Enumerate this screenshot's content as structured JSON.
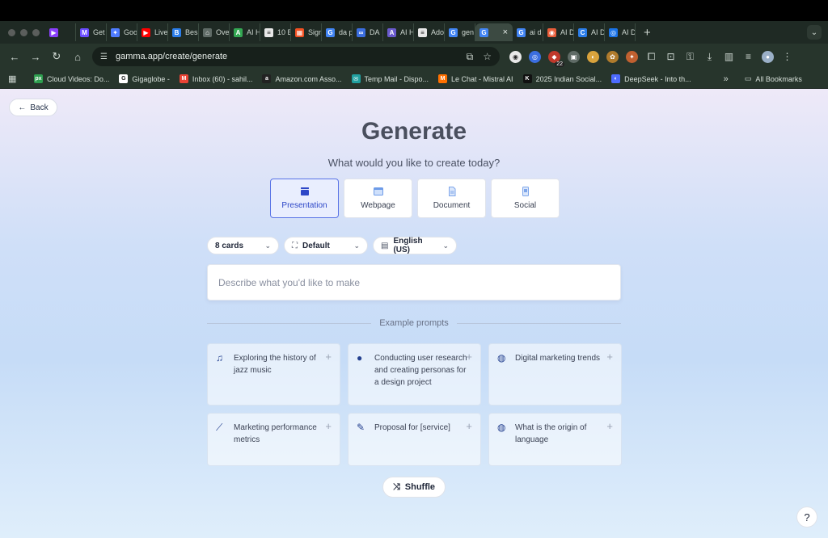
{
  "browser": {
    "tabs": [
      {
        "label": "",
        "fav": "▶",
        "color": "#8a3ffc"
      },
      {
        "label": "Get",
        "fav": "M",
        "color": "#6b4cff"
      },
      {
        "label": "Goo",
        "fav": "✦",
        "color": "#4f7cff"
      },
      {
        "label": "Live",
        "fav": "▶",
        "color": "#ff0000"
      },
      {
        "label": "Bes",
        "fav": "B",
        "color": "#2b7de9"
      },
      {
        "label": "Ove",
        "fav": "⌂",
        "color": "#5f6b66"
      },
      {
        "label": "AI H",
        "fav": "A",
        "color": "#34a853"
      },
      {
        "label": "10 B",
        "fav": "≡",
        "color": "#e8e8e8"
      },
      {
        "label": "Sign",
        "fav": "▦",
        "color": "#f25022"
      },
      {
        "label": "da p",
        "fav": "G",
        "color": "#4285f4"
      },
      {
        "label": "DA",
        "fav": "∞",
        "color": "#3b6ee0"
      },
      {
        "label": "AI H",
        "fav": "A",
        "color": "#6a5acd"
      },
      {
        "label": "Ado",
        "fav": "≡",
        "color": "#e8e8e8"
      },
      {
        "label": "gen",
        "fav": "G",
        "color": "#4285f4"
      }
    ],
    "active_tab": {
      "label": "G",
      "fav": "G"
    },
    "tabs_after": [
      {
        "label": "ai d",
        "fav": "G",
        "color": "#4285f4"
      },
      {
        "label": "AI D",
        "fav": "◉",
        "color": "#e85d3a"
      },
      {
        "label": "AI D",
        "fav": "C",
        "color": "#2b7de9"
      },
      {
        "label": "AI D",
        "fav": "◎",
        "color": "#1a73e8"
      }
    ],
    "new_tab": "+",
    "tab_menu": "⌄",
    "url": "gamma.app/create/generate",
    "ext_badge": "22",
    "bookmarks": [
      {
        "label": "Cloud Videos: Do...",
        "fav": "px",
        "color": "#2e9e4f"
      },
      {
        "label": "Gigaglobe -",
        "fav": "G",
        "color": "#ffffff"
      },
      {
        "label": "Inbox (60) - sahil...",
        "fav": "M",
        "color": "#ea4335"
      },
      {
        "label": "Amazon.com Asso...",
        "fav": "a",
        "color": "#222222"
      },
      {
        "label": "Temp Mail - Dispo...",
        "fav": "✉",
        "color": "#21a0a0"
      },
      {
        "label": "Le Chat - Mistral AI",
        "fav": "M",
        "color": "#ff7000"
      },
      {
        "label": "2025 Indian Social...",
        "fav": "K",
        "color": "#111111"
      },
      {
        "label": "DeepSeek - Into th...",
        "fav": "◐",
        "color": "#4d6bfe"
      }
    ],
    "bookmarks_more": "»",
    "all_bookmarks": "All Bookmarks"
  },
  "page": {
    "back_label": "Back",
    "title": "Generate",
    "subtitle": "What would you like to create today?",
    "types": [
      {
        "label": "Presentation",
        "icon": "presentation-icon",
        "active": true
      },
      {
        "label": "Webpage",
        "icon": "webpage-icon",
        "active": false
      },
      {
        "label": "Document",
        "icon": "document-icon",
        "active": false
      },
      {
        "label": "Social",
        "icon": "social-icon",
        "active": false
      }
    ],
    "cards_select": "8 cards",
    "theme_select": "Default",
    "language_select": "English (US)",
    "prompt_placeholder": "Describe what you'd like to make",
    "examples_heading": "Example prompts",
    "examples": [
      {
        "text": "Exploring the history of jazz music",
        "icon": "music-note-icon"
      },
      {
        "text": "Conducting user research and creating personas for a design project",
        "icon": "person-icon"
      },
      {
        "text": "Digital marketing trends",
        "icon": "globe-icon"
      },
      {
        "text": "Marketing performance metrics",
        "icon": "line-chart-icon"
      },
      {
        "text": "Proposal for [service]",
        "icon": "edit-document-icon"
      },
      {
        "text": "What is the origin of language",
        "icon": "globe-icon"
      }
    ],
    "shuffle_label": "Shuffle",
    "help_label": "?",
    "accent_color": "#2d47c7"
  }
}
